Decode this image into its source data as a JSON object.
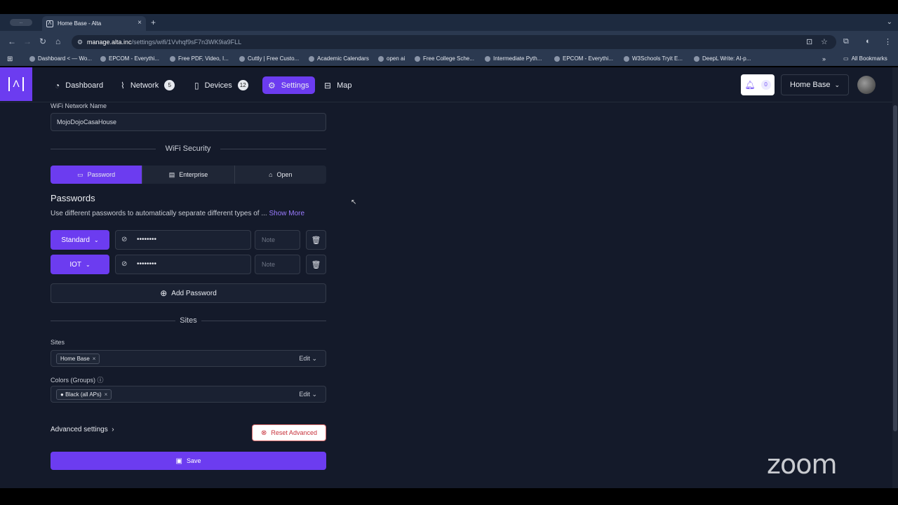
{
  "browser": {
    "pill_text": "...",
    "tab_title": "Home Base - Alta",
    "url_host": "manage.alta.inc",
    "url_path": "/settings/wifi/1Vvhqf9sF7n3WK9ia9FLL",
    "bookmarks": [
      "Dashboard < — Wo...",
      "EPCOM - Everythi...",
      "Free PDF, Video, I...",
      "Cuttly | Free Custo...",
      "Academic Calendars",
      "open ai",
      "Free College Sche...",
      "Intermediate Pyth...",
      "EPCOM - Everythi...",
      "W3Schools Tryit E...",
      "DeepL Write: AI-p..."
    ],
    "all_bookmarks": "All Bookmarks"
  },
  "nav": {
    "dashboard": "Dashboard",
    "network": "Network",
    "network_count": "5",
    "devices": "Devices",
    "devices_count": "12",
    "settings": "Settings",
    "map": "Map",
    "notif_count": "0",
    "site_selector": "Home Base"
  },
  "form": {
    "wifi_name_label": "WiFi Network Name",
    "wifi_name_value": "MojoDojoCasaHouse",
    "security_title": "WiFi Security",
    "security_tabs": [
      "Password",
      "Enterprise",
      "Open"
    ],
    "passwords_heading": "Passwords",
    "passwords_desc": "Use different passwords to automatically separate different types of ...",
    "show_more": "Show More",
    "passwords": [
      {
        "type": "Standard",
        "value": "••••••••",
        "note_placeholder": "Note"
      },
      {
        "type": "IOT",
        "value": "••••••••",
        "note_placeholder": "Note"
      }
    ],
    "add_password": "Add Password",
    "sites_title": "Sites",
    "sites_label": "Sites",
    "sites_chip": "Home Base",
    "edit": "Edit",
    "colors_label": "Colors (Groups)",
    "colors_chip": "Black (all APs)",
    "advanced_settings": "Advanced settings",
    "reset_advanced": "Reset Advanced",
    "save": "Save"
  },
  "overlay": {
    "zoom_watermark": "zoom"
  },
  "colors": {
    "accent": "#6c3cf0",
    "background": "#141a2a",
    "danger": "#c8323c"
  }
}
